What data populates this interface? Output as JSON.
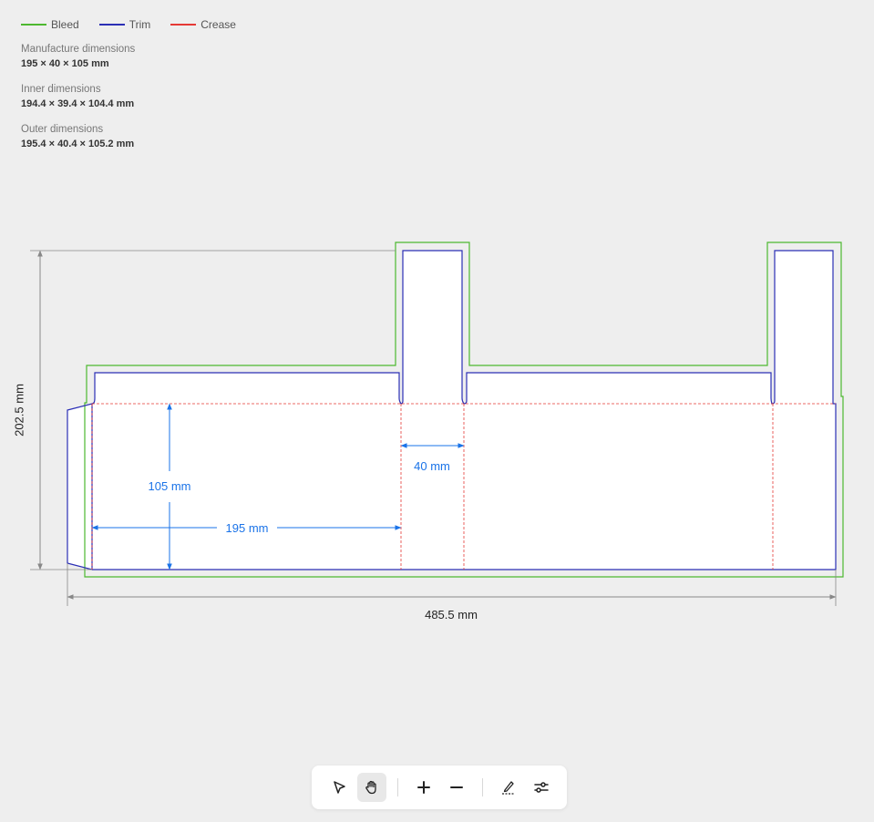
{
  "legend": [
    {
      "label": "Bleed",
      "color": "#4db830"
    },
    {
      "label": "Trim",
      "color": "#2b2fb5"
    },
    {
      "label": "Crease",
      "color": "#e53935"
    }
  ],
  "dimensions": {
    "manufacture": {
      "label": "Manufacture dimensions",
      "value": "195 × 40 × 105 mm"
    },
    "inner": {
      "label": "Inner dimensions",
      "value": "194.4 × 39.4 × 104.4 mm"
    },
    "outer": {
      "label": "Outer dimensions",
      "value": "195.4 × 40.4 × 105.2 mm"
    }
  },
  "drawing": {
    "overall_height_label": "202.5 mm",
    "overall_width_label": "485.5 mm",
    "length_label": "195 mm",
    "height_label": "105 mm",
    "width_label": "40 mm",
    "annotation_color": "#1a73e8",
    "dimension_line_color": "#888888"
  },
  "toolbar": {
    "tools": [
      {
        "name": "select-tool",
        "icon": "pointer-arrow-icon",
        "active": false
      },
      {
        "name": "pan-tool",
        "icon": "hand-icon",
        "active": true
      },
      {
        "name": "zoom-in",
        "icon": "plus-icon",
        "active": false
      },
      {
        "name": "zoom-out",
        "icon": "minus-icon",
        "active": false
      },
      {
        "name": "draw-tool",
        "icon": "pen-icon",
        "active": false
      },
      {
        "name": "settings-tool",
        "icon": "sliders-icon",
        "active": false
      }
    ]
  }
}
